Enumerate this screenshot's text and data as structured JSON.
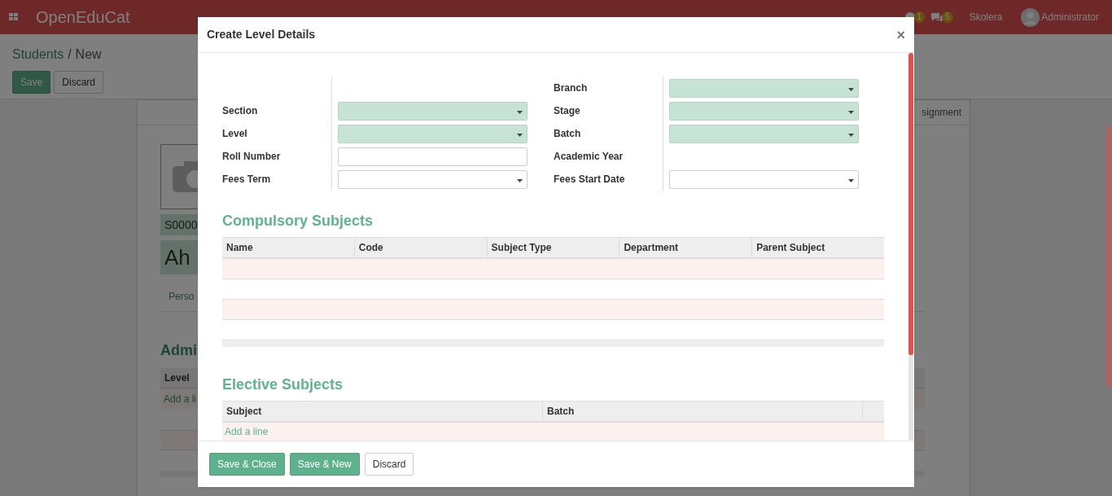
{
  "navbar": {
    "app_name": "OpenEduCat",
    "activity_count": "1",
    "message_count": "5",
    "company": "Skolera",
    "user": "Administrator"
  },
  "breadcrumb": {
    "parent": "Students",
    "separator": "/",
    "current": "New"
  },
  "page_buttons": [
    {
      "label": "Save",
      "primary": true
    },
    {
      "label": "Discard",
      "primary": false
    }
  ],
  "sheet": {
    "tab_visible": "signment",
    "code": "S0000",
    "name": "Ah",
    "page_tab": "Perso",
    "section_title": "Admi",
    "table_header": "Level",
    "add_line": "Add a li"
  },
  "dialog": {
    "title": "Create Level Details",
    "close": "×",
    "fields_left": [
      {
        "label": "Section",
        "kind": "select",
        "required": true
      },
      {
        "label": "Level",
        "kind": "select",
        "required": true
      },
      {
        "label": "Roll Number",
        "kind": "text",
        "required": false
      },
      {
        "label": "Fees Term",
        "kind": "select",
        "required": false
      }
    ],
    "fields_right": [
      {
        "label": "Branch",
        "kind": "select",
        "required": true
      },
      {
        "label": "Stage",
        "kind": "select",
        "required": true
      },
      {
        "label": "Batch",
        "kind": "select",
        "required": true
      },
      {
        "label": "Academic Year",
        "kind": "readonly"
      },
      {
        "label": "Fees Start Date",
        "kind": "select",
        "required": false
      }
    ],
    "compulsory": {
      "title": "Compulsory Subjects",
      "columns": [
        "Name",
        "Code",
        "Subject Type",
        "Department",
        "Parent Subject"
      ]
    },
    "elective": {
      "title": "Elective Subjects",
      "columns": [
        "Subject",
        "Batch"
      ],
      "add_line": "Add a line"
    },
    "buttons": [
      {
        "label": "Save & Close",
        "primary": true
      },
      {
        "label": "Save & New",
        "primary": true
      },
      {
        "label": "Discard",
        "primary": false
      }
    ]
  }
}
